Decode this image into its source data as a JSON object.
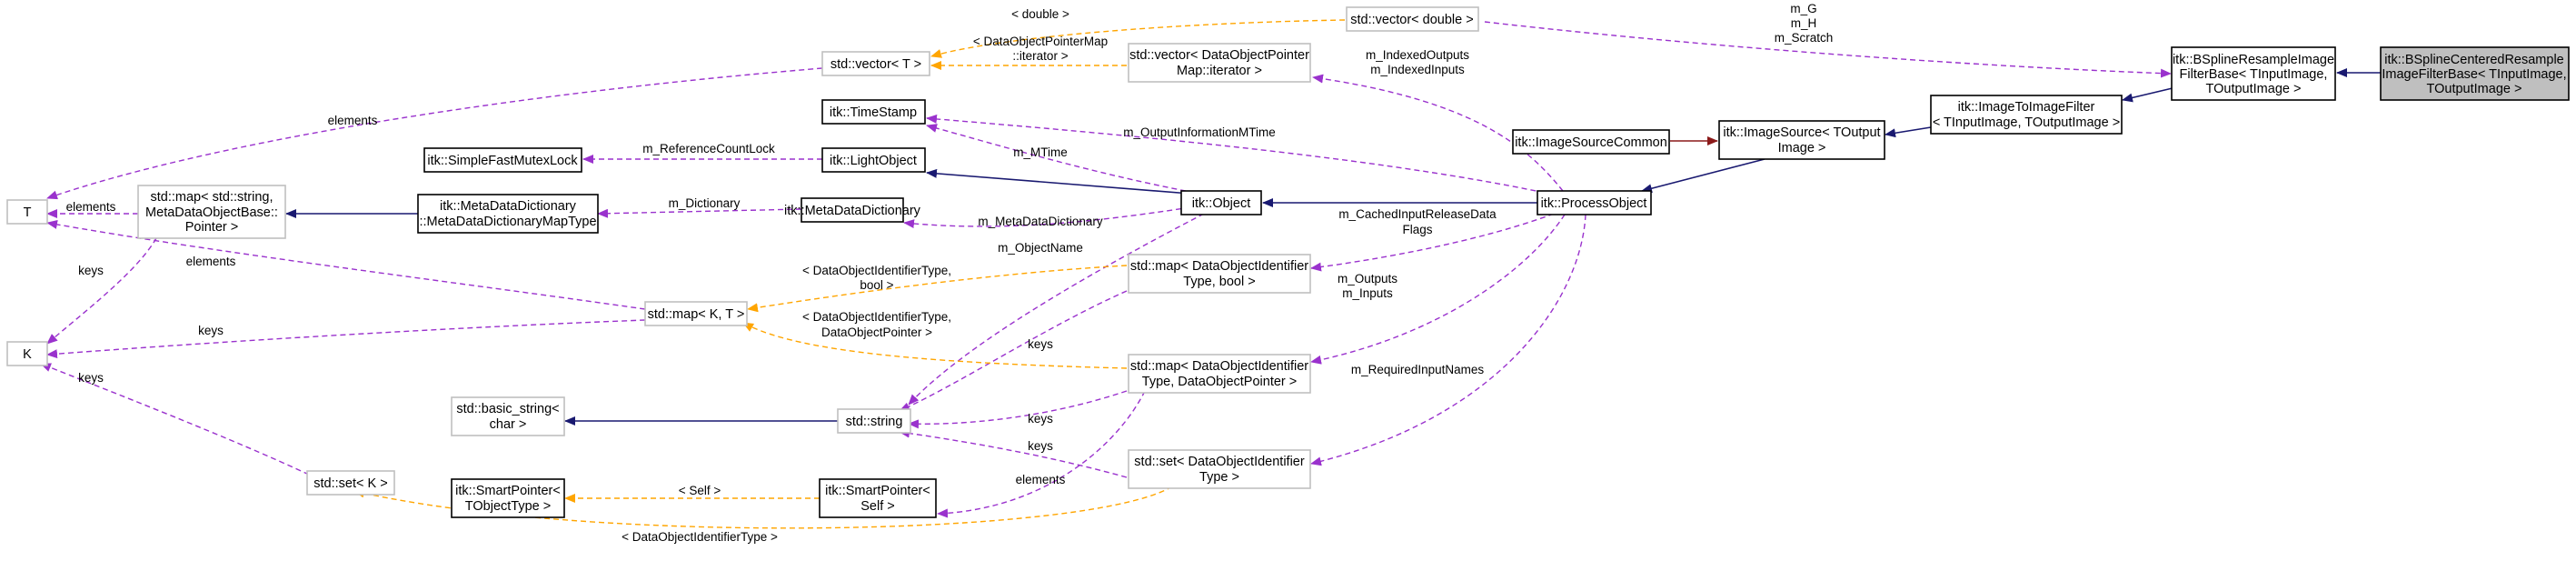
{
  "colors": {
    "usage": "#9a32cd",
    "template": "#ffa500",
    "inherit": "#191970",
    "private_inherit": "#8b1a1a",
    "node_border_black": "#000000",
    "node_border_gray": "#bfbfbf",
    "focus_fill": "#bfbfbf"
  },
  "nodes": [
    {
      "id": "centered",
      "lines": [
        "itk::BSplineCenteredResample",
        "ImageFilterBase< TInputImage,",
        "TOutputImage >"
      ],
      "style": "focus"
    },
    {
      "id": "resamplebase",
      "lines": [
        "itk::BSplineResampleImage",
        "FilterBase< TInputImage,",
        "TOutputImage >"
      ],
      "style": "black"
    },
    {
      "id": "imagetoimage",
      "lines": [
        "itk::ImageToImageFilter",
        "< TInputImage, TOutputImage >"
      ],
      "style": "black"
    },
    {
      "id": "imagesource",
      "lines": [
        "itk::ImageSource< TOutput",
        "Image >"
      ],
      "style": "black"
    },
    {
      "id": "imagesourcecommon",
      "lines": [
        "itk::ImageSourceCommon"
      ],
      "style": "black"
    },
    {
      "id": "processobject",
      "lines": [
        "itk::ProcessObject"
      ],
      "style": "black"
    },
    {
      "id": "object",
      "lines": [
        "itk::Object"
      ],
      "style": "black"
    },
    {
      "id": "lightobject",
      "lines": [
        "itk::LightObject"
      ],
      "style": "black"
    },
    {
      "id": "timestamp",
      "lines": [
        "itk::TimeStamp"
      ],
      "style": "black"
    },
    {
      "id": "mutexlock",
      "lines": [
        "itk::SimpleFastMutexLock"
      ],
      "style": "black"
    },
    {
      "id": "metadict",
      "lines": [
        "itk::MetaDataDictionary"
      ],
      "style": "black"
    },
    {
      "id": "metadictmap",
      "lines": [
        "itk::MetaDataDictionary",
        "::MetaDataDictionaryMapType"
      ],
      "style": "black"
    },
    {
      "id": "stdmapstring",
      "lines": [
        "std::map< std::string,",
        "MetaDataObjectBase::",
        "Pointer >"
      ],
      "style": "gray"
    },
    {
      "id": "T",
      "lines": [
        "T"
      ],
      "style": "gray"
    },
    {
      "id": "K",
      "lines": [
        "K"
      ],
      "style": "gray"
    },
    {
      "id": "stdvectorT",
      "lines": [
        "std::vector< T >"
      ],
      "style": "gray"
    },
    {
      "id": "stdvectordouble",
      "lines": [
        "std::vector< double >"
      ],
      "style": "gray"
    },
    {
      "id": "vectoriter",
      "lines": [
        "std::vector< DataObjectPointer",
        "Map::iterator >"
      ],
      "style": "gray"
    },
    {
      "id": "mapbool",
      "lines": [
        "std::map< DataObjectIdentifier",
        "Type, bool >"
      ],
      "style": "gray"
    },
    {
      "id": "mapKT",
      "lines": [
        "std::map< K, T >"
      ],
      "style": "gray"
    },
    {
      "id": "mapdop",
      "lines": [
        "std::map< DataObjectIdentifier",
        "Type, DataObjectPointer >"
      ],
      "style": "gray"
    },
    {
      "id": "basicstring",
      "lines": [
        "std::basic_string<",
        "char >"
      ],
      "style": "gray"
    },
    {
      "id": "string",
      "lines": [
        "std::string"
      ],
      "style": "gray"
    },
    {
      "id": "setK",
      "lines": [
        "std::set< K >"
      ],
      "style": "gray"
    },
    {
      "id": "setdoit",
      "lines": [
        "std::set< DataObjectIdentifier",
        "Type >"
      ],
      "style": "gray"
    },
    {
      "id": "spTObject",
      "lines": [
        "itk::SmartPointer<",
        "TObjectType >"
      ],
      "style": "black"
    },
    {
      "id": "spSelf",
      "lines": [
        "itk::SmartPointer<",
        "Self >"
      ],
      "style": "black"
    }
  ],
  "edges": [
    {
      "id": "centered-resamplebase",
      "type": "inherit"
    },
    {
      "id": "resamplebase-imagetoimage",
      "type": "inherit"
    },
    {
      "id": "imagetoimage-imagesource",
      "type": "inherit"
    },
    {
      "id": "imagesource-processobject",
      "type": "inherit"
    },
    {
      "id": "imagesourcecommon-imagesource",
      "type": "private_inherit"
    },
    {
      "id": "processobject-object",
      "type": "inherit"
    },
    {
      "id": "object-lightobject",
      "type": "inherit"
    },
    {
      "id": "metadictmap-stdmapstring",
      "type": "inherit"
    },
    {
      "id": "basicstring-string",
      "type": "inherit"
    },
    {
      "id": "stdvectordouble-resamplebase",
      "type": "usage"
    },
    {
      "id": "vectoriter-processobject",
      "type": "usage"
    },
    {
      "id": "timestamp-processobject",
      "type": "usage"
    },
    {
      "id": "timestamp-object",
      "type": "usage"
    },
    {
      "id": "mutexlock-lightobject",
      "type": "usage"
    },
    {
      "id": "metadictmap-metadict",
      "type": "usage"
    },
    {
      "id": "metadict-object",
      "type": "usage"
    },
    {
      "id": "string-object",
      "type": "usage"
    },
    {
      "id": "mapbool-processobject",
      "type": "usage"
    },
    {
      "id": "mapdop-processobject",
      "type": "usage"
    },
    {
      "id": "setdoit-processobject",
      "type": "usage"
    },
    {
      "id": "T-stdvectorT",
      "type": "usage"
    },
    {
      "id": "T-stdmapstring",
      "type": "usage"
    },
    {
      "id": "T-mapKT",
      "type": "usage"
    },
    {
      "id": "K-stdmapstring",
      "type": "usage"
    },
    {
      "id": "K-mapKT",
      "type": "usage"
    },
    {
      "id": "K-setK",
      "type": "usage"
    },
    {
      "id": "string-mapbool",
      "type": "usage"
    },
    {
      "id": "string-mapdop",
      "type": "usage"
    },
    {
      "id": "string-setdoit",
      "type": "usage"
    },
    {
      "id": "spSelf-mapdop",
      "type": "usage"
    },
    {
      "id": "stdvectordouble-stdvectorT",
      "type": "template"
    },
    {
      "id": "vectoriter-stdvectorT",
      "type": "template"
    },
    {
      "id": "mapbool-mapKT",
      "type": "template"
    },
    {
      "id": "mapdop-mapKT",
      "type": "template"
    },
    {
      "id": "spTObject-spSelf",
      "type": "template"
    },
    {
      "id": "setdoit-setK",
      "type": "template"
    }
  ],
  "labels": {
    "m_G": "m_G",
    "m_H": "m_H",
    "m_Scratch": "m_Scratch",
    "double_tpl": "< double >",
    "dopm_tpl_1": "< DataObjectPointerMap",
    "dopm_tpl_2": "::iterator >",
    "elements_vec": "elements",
    "m_IndexedOutputs": "m_IndexedOutputs",
    "m_IndexedInputs": "m_IndexedInputs",
    "m_OutputInformationMTime": "m_OutputInformationMTime",
    "m_MTime": "m_MTime",
    "m_ReferenceCountLock": "m_ReferenceCountLock",
    "m_Dictionary": "m_Dictionary",
    "m_MetaDataDictionary": "m_MetaDataDictionary",
    "m_CachedInputReleaseDataFlags_1": "m_CachedInputReleaseData",
    "m_CachedInputReleaseDataFlags_2": "Flags",
    "m_ObjectName": "m_ObjectName",
    "elements_map": "elements",
    "elements_mapKT": "elements",
    "keys_map": "keys",
    "doit_bool_1": "< DataObjectIdentifierType,",
    "doit_bool_2": "bool >",
    "doit_dop_1": "< DataObjectIdentifierType,",
    "doit_dop_2": "DataObjectPointer >",
    "keys_mapKT": "keys",
    "keys_mapbool": "keys",
    "m_Outputs": "m_Outputs",
    "m_Inputs": "m_Inputs",
    "m_RequiredInputNames": "m_RequiredInputNames",
    "keys_setK": "keys",
    "keys_mapdop": "keys",
    "keys_setdoit": "keys",
    "self_tpl": "< Self >",
    "elements_sp": "elements",
    "doit_set_tpl": "< DataObjectIdentifierType >"
  }
}
